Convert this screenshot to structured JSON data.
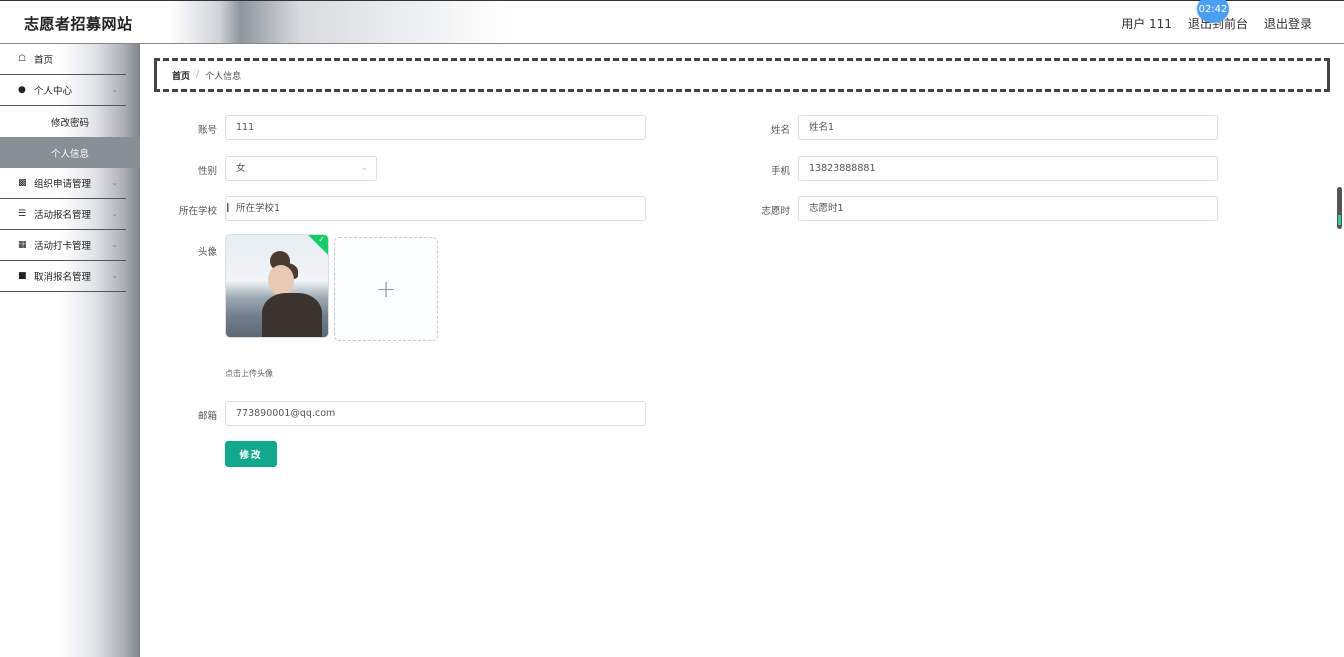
{
  "header": {
    "site_title": "志愿者招募网站",
    "user_label": "用户 111",
    "back_label": "退出到前台",
    "logout_label": "退出登录",
    "timer": "02:42"
  },
  "sidebar": {
    "items": [
      {
        "label": "首页",
        "icon": "home-icon"
      },
      {
        "label": "个人中心",
        "icon": "user-icon"
      },
      {
        "label": "组织申请管理",
        "icon": "chat-icon"
      },
      {
        "label": "活动报名管理",
        "icon": "list-icon"
      },
      {
        "label": "活动打卡管理",
        "icon": "grid-icon"
      },
      {
        "label": "取消报名管理",
        "icon": "chart-icon"
      }
    ],
    "submenu": [
      {
        "label": "修改密码"
      },
      {
        "label": "个人信息",
        "active": true
      }
    ]
  },
  "breadcrumb": {
    "home": "首页",
    "separator": "/",
    "current": "个人信息"
  },
  "form": {
    "account_label": "账号",
    "account_value": "111",
    "name_label": "姓名",
    "name_value": "姓名1",
    "gender_label": "性别",
    "gender_value": "女",
    "phone_label": "手机",
    "phone_value": "13823888881",
    "school_label": "所在学校",
    "school_value": "所在学校1",
    "volunteer_hours_label": "志愿时",
    "volunteer_hours_value": "志愿时1",
    "avatar_label": "头像",
    "upload_tip": "点击上传头像",
    "email_label": "邮箱",
    "email_value": "773890001@qq.com",
    "submit_label": "修改"
  },
  "colors": {
    "accent": "#11a88d",
    "success": "#13ce66",
    "timer_badge": "#4a9ff5"
  }
}
